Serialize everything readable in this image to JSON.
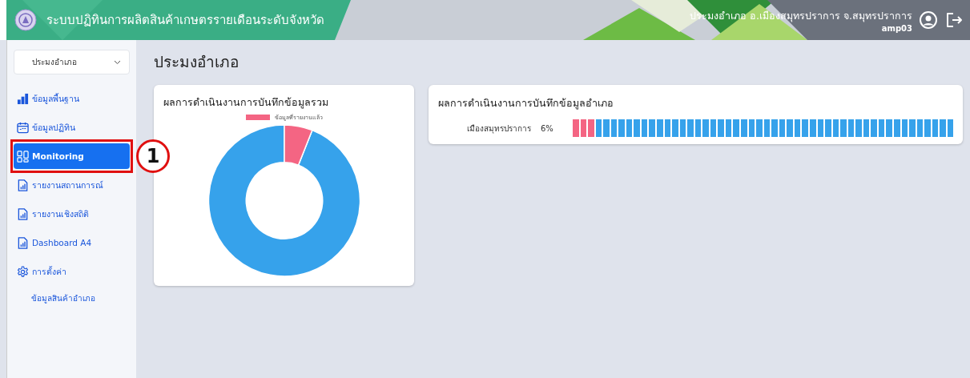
{
  "header": {
    "title": "ระบบปฏิทินการผลิตสินค้าเกษตรรายเดือนระดับจังหวัด",
    "user_name": "ประมงอำเภอ อ.เมืองสมุทรปราการ จ.สมุทรปราการ",
    "user_id": "amp03"
  },
  "sidebar": {
    "role_select": "ประมงอำเภอ",
    "items": [
      {
        "label": "ข้อมูลพื้นฐาน",
        "kind": "bars",
        "selected": false
      },
      {
        "label": "ข้อมูลปฏิทิน",
        "kind": "calendar",
        "selected": false
      },
      {
        "label": "Monitoring",
        "kind": "grid",
        "selected": true,
        "annotation": "1"
      },
      {
        "label": "รายงานสถานการณ์",
        "kind": "report",
        "selected": false
      },
      {
        "label": "รายงานเชิงสถิติ",
        "kind": "report",
        "selected": false
      },
      {
        "label": "Dashboard A4",
        "kind": "report",
        "selected": false
      },
      {
        "label": "การตั้งค่า",
        "kind": "gear",
        "selected": false,
        "children": [
          {
            "label": "ข้อมูลสินค้าอำเภอ",
            "selected": false
          }
        ]
      }
    ]
  },
  "page_title": "ประมงอำเภอ",
  "summary_card": {
    "title": "ผลการดำเนินงานการบันทึกข้อมูลรวม",
    "legend": [
      {
        "label": "ข้อมูลที่รายงานแล้ว",
        "color": "#f46583"
      }
    ]
  },
  "district_card": {
    "title": "ผลการดำเนินงานการบันทึกข้อมูลอำเภอ",
    "rows": [
      {
        "name": "เมืองสมุทรปราการ",
        "percent": "6%"
      }
    ]
  }
}
